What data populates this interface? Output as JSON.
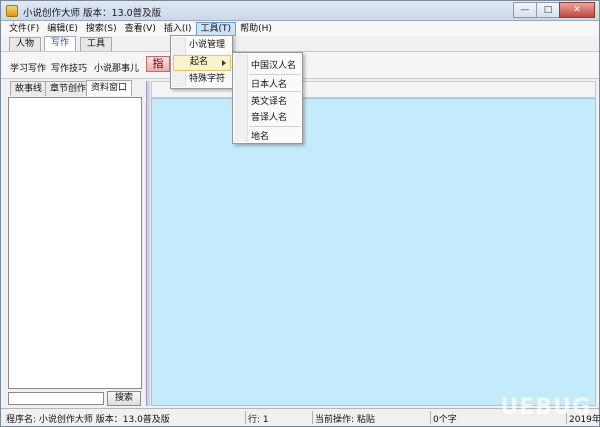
{
  "window": {
    "title": "小说创作大师 版本：13.0普及版",
    "min_label": "—",
    "max_label": "□",
    "close_label": "✕"
  },
  "menubar": {
    "file": "文件(F)",
    "edit": "编辑(E)",
    "search": "搜索(S)",
    "view": "查看(V)",
    "insert": "插入(I)",
    "tools": "工具(T)",
    "help": "帮助(H)"
  },
  "tabs": {
    "characters": "人物",
    "writing": "写作",
    "tools": "工具"
  },
  "subtoolbar": {
    "learn": "学习写作",
    "tips": "写作技巧",
    "stories": "小说那事儿",
    "red_button": "指"
  },
  "left_tabs": {
    "storyline": "故事线",
    "chapters": "章节创作",
    "materials": "资料窗口"
  },
  "search": {
    "value": "",
    "button": "搜索"
  },
  "tools_menu": {
    "novel_manage": "小说管理",
    "naming": "起名",
    "special_chars": "特殊字符"
  },
  "naming_submenu": {
    "chinese": "中国汉人名",
    "japanese": "日本人名",
    "english": "英文译名",
    "phonetic": "音译人名",
    "place": "地名"
  },
  "statusbar": {
    "program": "程序名: 小说创作大师 版本：13.0普及版",
    "line": "行: 1",
    "operation": "当前操作: 粘贴",
    "chars": "0个字",
    "year": "2019年"
  },
  "watermark": "UEBUG"
}
